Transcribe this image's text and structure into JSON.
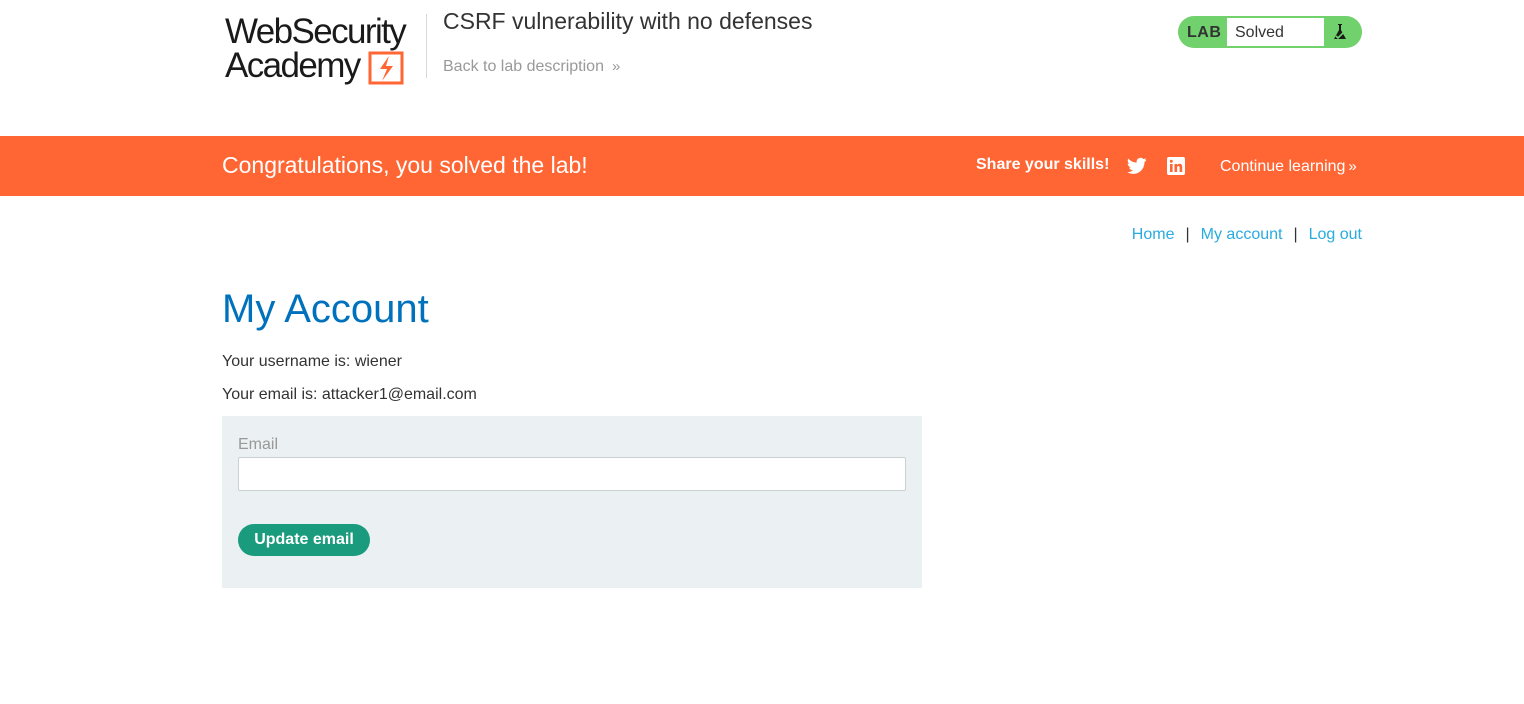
{
  "header": {
    "logo": {
      "line1": "WebSecurity",
      "line2": "Academy"
    },
    "lab_title": "CSRF vulnerability with no defenses",
    "back_link": "Back to lab description",
    "back_chevron": "»"
  },
  "lab_status": {
    "badge": "LAB",
    "status": "Solved",
    "icon": "flask-icon",
    "color": "#70d16d"
  },
  "banner": {
    "message": "Congratulations, you solved the lab!",
    "share_label": "Share your skills!",
    "share_icons": [
      "twitter-icon",
      "linkedin-icon"
    ],
    "continue_link": "Continue learning",
    "continue_chevron": "»",
    "color": "#ff6633"
  },
  "nav": {
    "home": "Home",
    "separator": "|",
    "my_account": "My account",
    "log_out": "Log out"
  },
  "main": {
    "title": "My Account",
    "username_line": "Your username is: wiener",
    "email_line": "Your email is: attacker1@email.com",
    "form": {
      "email_label": "Email",
      "email_value": "",
      "submit_label": "Update email",
      "button_color": "#1a9b7e"
    }
  }
}
